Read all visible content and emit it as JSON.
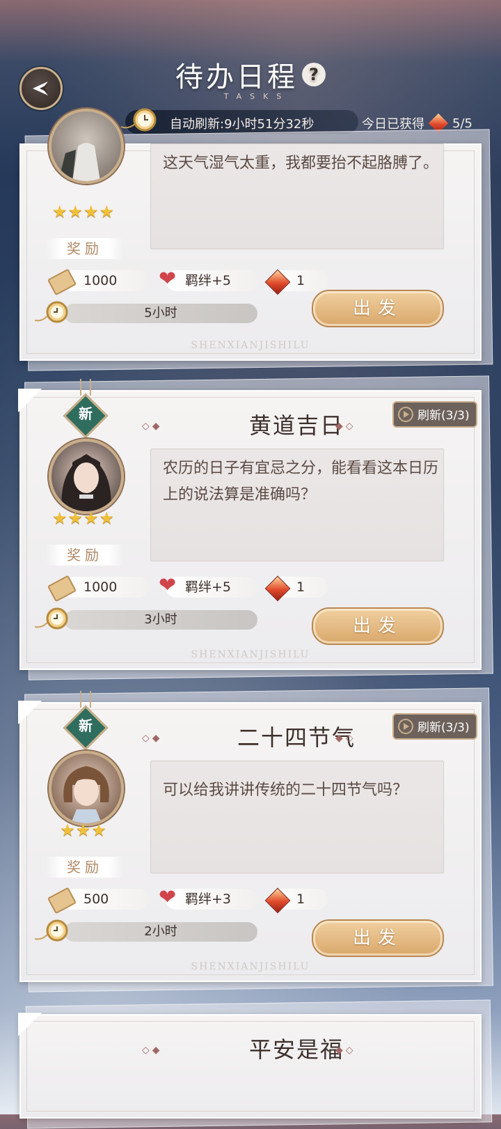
{
  "header": {
    "title": "待办日程",
    "subtitle": "TASKS",
    "help_icon": "?",
    "auto_refresh": "自动刷新:9小时51分32秒",
    "earned_label": "今日已获得",
    "earned_value": "5/5"
  },
  "watermark": "SHENXIANJISHILU",
  "tasks": [
    {
      "title": "",
      "dialog": "这天气湿气太重，我都要抬不起胳膊了。",
      "stars": "★★★★",
      "reward_label": "奖励",
      "coins": "1000",
      "bond": "羁绊+5",
      "gems": "1",
      "duration": "5小时",
      "go_label": "出发"
    },
    {
      "title": "黄道吉日",
      "new_label": "新",
      "refresh_label": "刷新(3/3)",
      "dialog": "农历的日子有宜忌之分，能看看这本日历上的说法算是准确吗？",
      "stars": "★★★★",
      "reward_label": "奖励",
      "coins": "1000",
      "bond": "羁绊+5",
      "gems": "1",
      "duration": "3小时",
      "go_label": "出发"
    },
    {
      "title": "二十四节气",
      "new_label": "新",
      "refresh_label": "刷新(3/3)",
      "dialog": "可以给我讲讲传统的二十四节气吗？",
      "stars": "★★★",
      "reward_label": "奖励",
      "coins": "500",
      "bond": "羁绊+3",
      "gems": "1",
      "duration": "2小时",
      "go_label": "出发"
    },
    {
      "title": "平安是福"
    }
  ],
  "icons": {
    "back": "back-arrow-icon",
    "watch": "pocket-watch-icon",
    "ticket": "ticket-icon",
    "heart": "heart-icon",
    "gem": "red-gem-icon"
  },
  "colors": {
    "accent_gold": "#d9a76a",
    "badge_green": "#2f6d5e",
    "text_brown": "#3d302c"
  }
}
